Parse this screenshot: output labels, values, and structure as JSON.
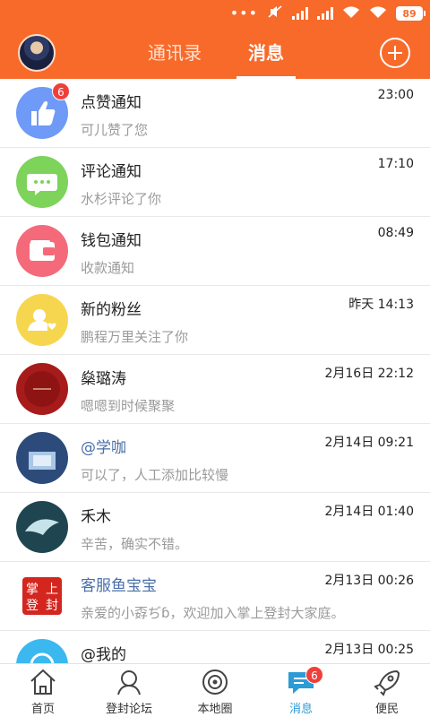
{
  "status_bar": {
    "battery": "89",
    "signal_1": "HD",
    "signal_2": "HD"
  },
  "header": {
    "tabs": [
      {
        "label": "通讯录"
      },
      {
        "label": "消息",
        "active": true
      }
    ],
    "add_icon": "plus-circle-icon"
  },
  "messages": [
    {
      "name": "点赞通知",
      "preview": "可儿赞了您",
      "time": "23:00",
      "badge": "6",
      "avatar": "thumbs-up-icon",
      "color": "#6f9af7"
    },
    {
      "name": "评论通知",
      "preview": "水杉评论了你",
      "time": "17:10",
      "avatar": "comment-icon",
      "color": "#7ed35a"
    },
    {
      "name": "钱包通知",
      "preview": "收款通知",
      "time": "08:49",
      "avatar": "wallet-icon",
      "color": "#f46a7a"
    },
    {
      "name": "新的粉丝",
      "preview": "鹏程万里关注了你",
      "time": "昨天 14:13",
      "avatar": "new-fan-icon",
      "color": "#f7d64f"
    },
    {
      "name": "燊璐涛",
      "preview": "嗯嗯到时候聚聚",
      "time": "2月16日 22:12",
      "avatar": "user-avatar"
    },
    {
      "name": "@学咖",
      "preview": "可以了，人工添加比较慢",
      "time": "2月14日 09:21",
      "avatar": "user-avatar"
    },
    {
      "name": "禾木",
      "preview": "辛苦，确实不错。",
      "time": "2月14日 01:40",
      "avatar": "user-avatar"
    },
    {
      "name": "客服鱼宝宝",
      "preview": "亲爱的小孬ぢɓ，欢迎加入掌上登封大家庭。",
      "time": "2月13日 00:26",
      "avatar": "brand-avatar",
      "avatar_text": [
        "掌",
        "上",
        "登",
        "封"
      ]
    },
    {
      "name": "@我的",
      "preview": "",
      "time": "2月13日 00:25",
      "avatar": "at-icon",
      "color": "#3bb8f0"
    }
  ],
  "bottom_nav": [
    {
      "label": "首页",
      "icon": "home-icon"
    },
    {
      "label": "登封论坛",
      "icon": "forum-icon"
    },
    {
      "label": "本地圈",
      "icon": "local-circle-icon"
    },
    {
      "label": "消息",
      "icon": "message-icon",
      "badge": "6",
      "active": true
    },
    {
      "label": "便民",
      "icon": "rocket-icon"
    }
  ],
  "colors": {
    "brand": "#f86a2a",
    "active_nav": "#2c9bd6",
    "badge": "#ef3f3a"
  }
}
